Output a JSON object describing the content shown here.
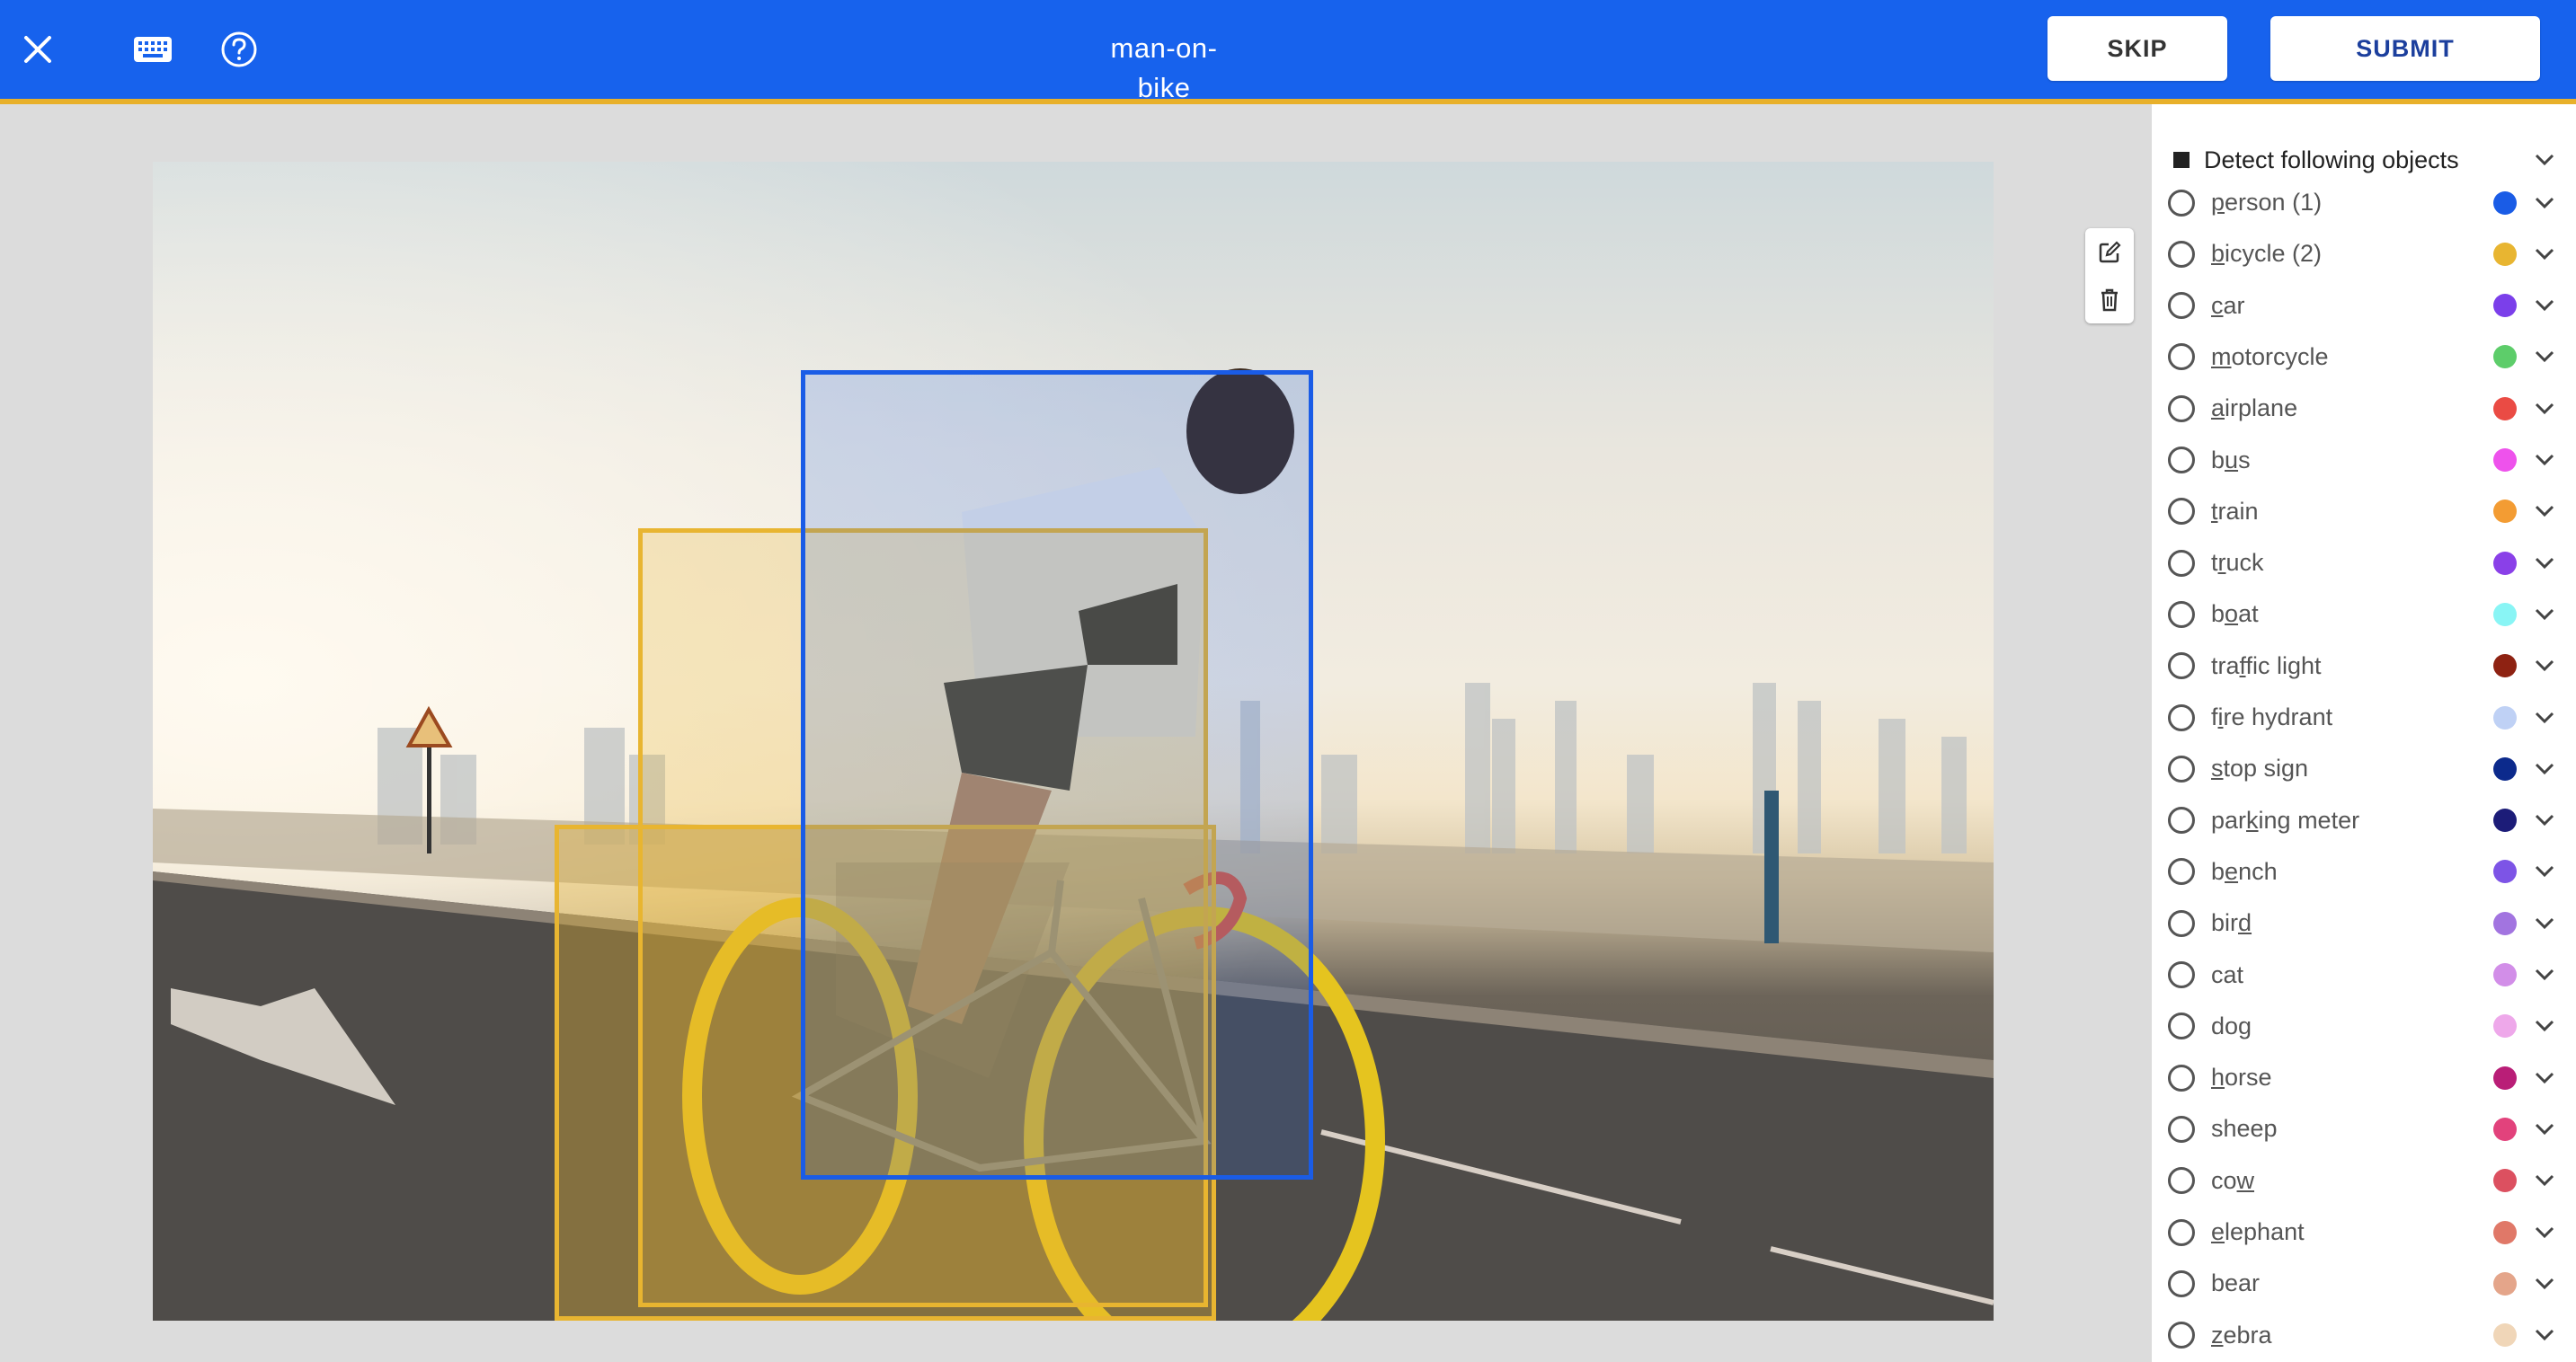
{
  "topbar": {
    "title": "man-on-bike",
    "skip_label": "SKIP",
    "submit_label": "SUBMIT",
    "colors": {
      "bar": "#1762ed",
      "accent": "#e8b02a"
    },
    "icons": [
      "close-icon",
      "keyboard-icon",
      "help-icon"
    ]
  },
  "tools": {
    "icons": [
      "edit-icon",
      "trash-icon"
    ]
  },
  "boxes": [
    {
      "label": "person",
      "color": "#1a5ce6"
    },
    {
      "label": "bicycle",
      "color": "#e8b531"
    },
    {
      "label": "bicycle",
      "color": "#e8b531"
    }
  ],
  "sidebar": {
    "header": "Detect following objects",
    "items": [
      {
        "pre": "",
        "ul": "p",
        "post": "erson (1)",
        "color": "#1a5ce6"
      },
      {
        "pre": "",
        "ul": "b",
        "post": "icycle (2)",
        "color": "#e8b531"
      },
      {
        "pre": "",
        "ul": "c",
        "post": "ar",
        "color": "#7b3fea"
      },
      {
        "pre": "",
        "ul": "m",
        "post": "otorcycle",
        "color": "#5dcd6a"
      },
      {
        "pre": "",
        "ul": "a",
        "post": "irplane",
        "color": "#ea4b44"
      },
      {
        "pre": "b",
        "ul": "u",
        "post": "s",
        "color": "#ee52ec"
      },
      {
        "pre": "",
        "ul": "t",
        "post": "rain",
        "color": "#f39c33"
      },
      {
        "pre": "t",
        "ul": "r",
        "post": "uck",
        "color": "#8a40e8"
      },
      {
        "pre": "b",
        "ul": "o",
        "post": "at",
        "color": "#89f5f5"
      },
      {
        "pre": "tra",
        "ul": "f",
        "post": "fic light",
        "color": "#8e2212"
      },
      {
        "pre": "f",
        "ul": "i",
        "post": "re hydrant",
        "color": "#bfd1f5"
      },
      {
        "pre": "",
        "ul": "s",
        "post": "top sign",
        "color": "#0c2a8c"
      },
      {
        "pre": "par",
        "ul": "k",
        "post": "ing meter",
        "color": "#1c1c78"
      },
      {
        "pre": "b",
        "ul": "e",
        "post": "nch",
        "color": "#7d54e6"
      },
      {
        "pre": "bir",
        "ul": "d",
        "post": "",
        "color": "#a274e0"
      },
      {
        "pre": "cat",
        "ul": "",
        "post": "",
        "color": "#d28ee8"
      },
      {
        "pre": "dog",
        "ul": "",
        "post": "",
        "color": "#eea8ea"
      },
      {
        "pre": "",
        "ul": "h",
        "post": "orse",
        "color": "#b91e77"
      },
      {
        "pre": "sheep",
        "ul": "",
        "post": "",
        "color": "#e2427c"
      },
      {
        "pre": "co",
        "ul": "w",
        "post": "",
        "color": "#dc5060"
      },
      {
        "pre": "",
        "ul": "e",
        "post": "lephant",
        "color": "#e07868"
      },
      {
        "pre": "bear",
        "ul": "",
        "post": "",
        "color": "#e4a58a"
      },
      {
        "pre": "",
        "ul": "z",
        "post": "ebra",
        "color": "#f0d6b8"
      }
    ]
  }
}
